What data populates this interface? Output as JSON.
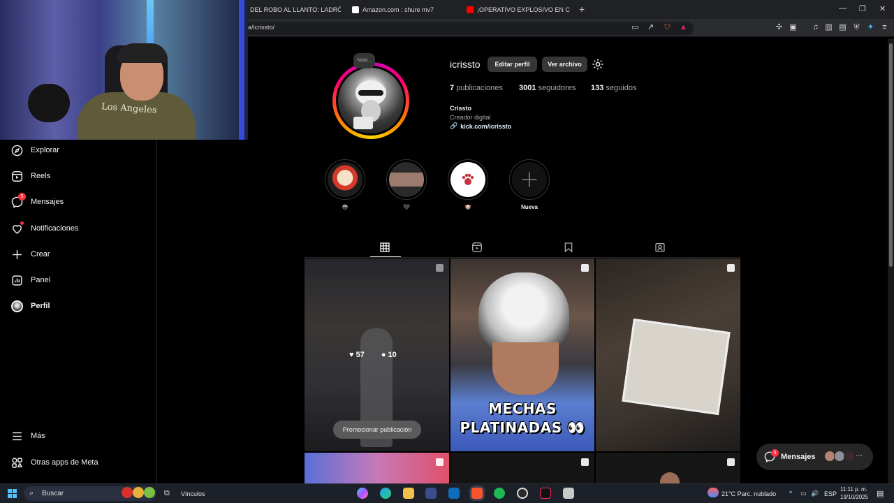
{
  "browser": {
    "tabs": [
      {
        "label": "DEL ROBO AL LLANTO: LADRÓN"
      },
      {
        "label": "Amazon.com : shure mv7"
      },
      {
        "label": "¡OPERATIVO EXPLOSIVO EN CA"
      }
    ],
    "new_tab": "+",
    "url": "a/icrissto/",
    "window_controls": {
      "minimize": "—",
      "maximize": "❐",
      "close": "✕"
    }
  },
  "sidebar": {
    "items": [
      {
        "label": "Explorar",
        "icon": "compass-icon"
      },
      {
        "label": "Reels",
        "icon": "reels-icon"
      },
      {
        "label": "Mensajes",
        "icon": "messenger-icon",
        "badge": "5"
      },
      {
        "label": "Notificaciones",
        "icon": "heart-icon"
      },
      {
        "label": "Crear",
        "icon": "plus-icon"
      },
      {
        "label": "Panel",
        "icon": "dashboard-icon"
      },
      {
        "label": "Perfil",
        "icon": "avatar-icon"
      }
    ],
    "bottom": [
      {
        "label": "Más",
        "icon": "menu-icon"
      },
      {
        "label": "Otras apps de Meta",
        "icon": "apps-icon"
      }
    ]
  },
  "profile": {
    "note": "Nota...",
    "username": "icrissto",
    "edit_button": "Editar perfil",
    "archive_button": "Ver archivo",
    "stats": {
      "posts_count": "7",
      "posts_label": "publicaciones",
      "followers_count": "3001",
      "followers_label": "seguidores",
      "following_count": "133",
      "following_label": "seguidos"
    },
    "bio": {
      "name": "Crissto",
      "category": "Creador digital",
      "link": "kick.com/icrissto"
    }
  },
  "highlights": [
    {
      "label": "😳"
    },
    {
      "label": "🖤"
    },
    {
      "label": "🐶"
    },
    {
      "label": "Nueva"
    }
  ],
  "posts": {
    "first": {
      "likes": "57",
      "comments": "10",
      "promote": "Promocionar publicación"
    },
    "second": {
      "caption_line1": "MECHAS",
      "caption_line2": "PLATINADAS 👀"
    }
  },
  "messages_pill": {
    "label": "Mensajes",
    "badge": "5",
    "more": "···"
  },
  "taskbar": {
    "search": "Buscar",
    "vinculos": "Vínculos",
    "weather": "21°C  Parc. nublado",
    "lang": "ESP",
    "time": "11:11 p. m.",
    "date": "19/10/2025"
  },
  "colors": {
    "accent_blue": "#0095f6",
    "badge_red": "#ff3040",
    "surface": "#363636"
  }
}
